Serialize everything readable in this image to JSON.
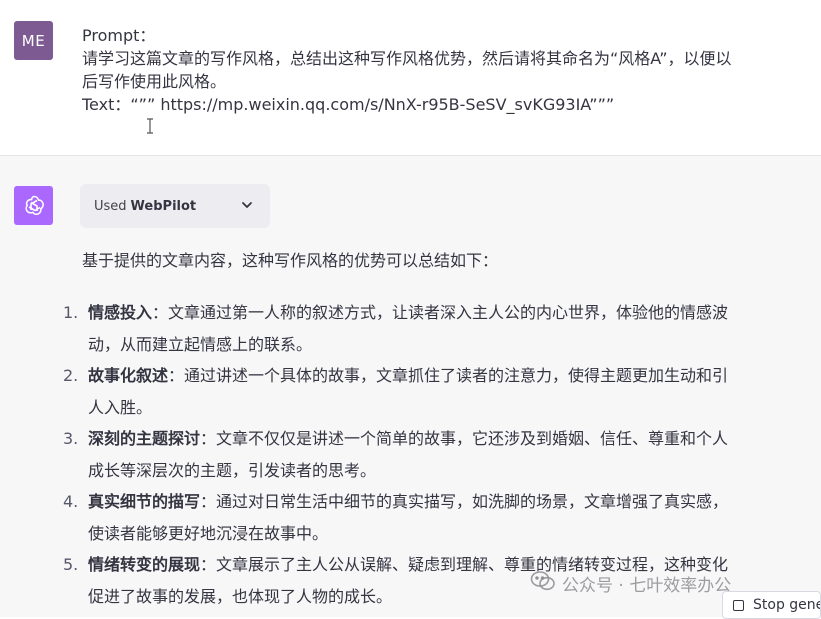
{
  "user": {
    "avatar_initials": "ME",
    "prompt_label": "Prompt：",
    "prompt_line1": "请学习这篇文章的写作风格，总结出这种写作风格优势，然后请将其命名为“风格A”，以便以",
    "prompt_line2": "后写作使用此风格。",
    "text_line": "Text：“”” https://mp.weixin.qq.com/s/NnX-r95B-SeSV_svKG93IA”””"
  },
  "assistant": {
    "avatar_icon": "openai-logo-icon",
    "plugin_used_label": "Used",
    "plugin_name": "WebPilot",
    "intro": "基于提供的文章内容，这种写作风格的优势可以总结如下：",
    "items": [
      {
        "num": "1.",
        "title": "情感投入",
        "line1": "：文章通过第一人称的叙述方式，让读者深入主人公的内心世界，体验他的情感波",
        "line2": "动，从而建立起情感上的联系。"
      },
      {
        "num": "2.",
        "title": "故事化叙述",
        "line1": "：通过讲述一个具体的故事，文章抓住了读者的注意力，使得主题更加生动和引",
        "line2": "人入胜。"
      },
      {
        "num": "3.",
        "title": "深刻的主题探讨",
        "line1": "：文章不仅仅是讲述一个简单的故事，它还涉及到婚姻、信任、尊重和个人",
        "line2": "成长等深层次的主题，引发读者的思考。"
      },
      {
        "num": "4.",
        "title": "真实细节的描写",
        "line1": "：通过对日常生活中细节的真实描写，如洗脚的场景，文章增强了真实感，",
        "line2": "使读者能够更好地沉浸在故事中。"
      },
      {
        "num": "5.",
        "title": "情绪转变的展现",
        "line1": "：文章展示了主人公从误解、疑虑到理解、尊重的情绪转变过程，这种变化",
        "line2": "促进了故事的发展，也体现了人物的成长。"
      }
    ]
  },
  "stop_button": {
    "label": "Stop gene"
  },
  "watermark": {
    "text": "公众号 · 七叶效率办公"
  },
  "colors": {
    "user_avatar": "#7d5a92",
    "bot_avatar": "#ab68ff",
    "assistant_bg": "#f7f7f8",
    "text": "#343541"
  }
}
